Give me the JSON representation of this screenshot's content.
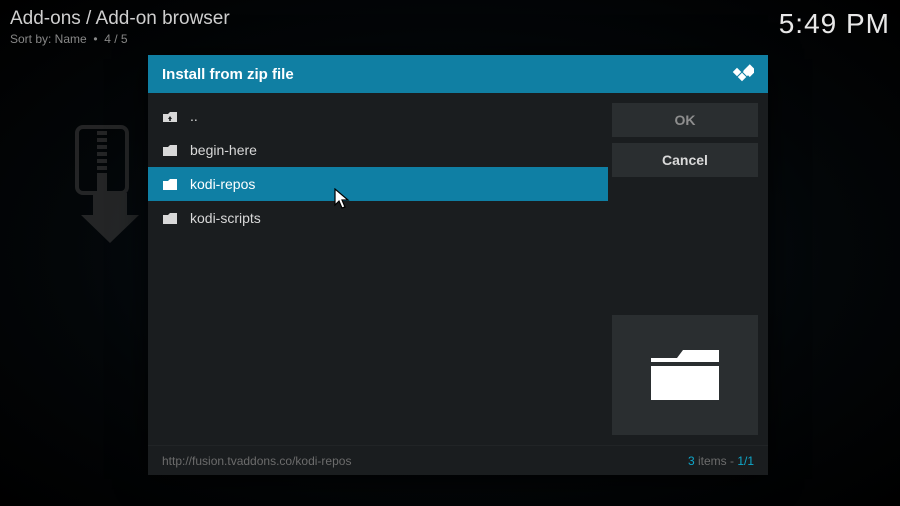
{
  "header": {
    "breadcrumb": "Add-ons / Add-on browser",
    "sort_label": "Sort by: Name",
    "sort_sep": "•",
    "sort_count": "4 / 5",
    "clock": "5:49 PM"
  },
  "dialog": {
    "title": "Install from zip file",
    "buttons": {
      "ok": "OK",
      "cancel": "Cancel"
    },
    "items": [
      {
        "label": "..",
        "icon": "up",
        "selected": false
      },
      {
        "label": "begin-here",
        "icon": "folder",
        "selected": false
      },
      {
        "label": "kodi-repos",
        "icon": "folder",
        "selected": true
      },
      {
        "label": "kodi-scripts",
        "icon": "folder",
        "selected": false
      }
    ],
    "footer": {
      "path": "http://fusion.tvaddons.co/kodi-repos",
      "items_count": "3",
      "items_word": " items - ",
      "page": "1/1"
    }
  }
}
